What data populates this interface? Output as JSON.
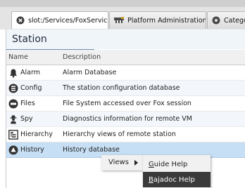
{
  "tabs": [
    {
      "label": "slot:/Services/FoxService",
      "icon": "close-circle-icon"
    },
    {
      "label": "Platform Administration",
      "icon": "platform-admin-icon"
    },
    {
      "label": "Catego",
      "icon": "category-icon"
    }
  ],
  "view": {
    "title": "Station",
    "columns": {
      "name": "Name",
      "description": "Description"
    },
    "rows": [
      {
        "name": "Alarm",
        "description": "Alarm Database",
        "icon": "bell-icon"
      },
      {
        "name": "Config",
        "description": "The station configuration database",
        "icon": "database-icon"
      },
      {
        "name": "Files",
        "description": "File System accessed over Fox session",
        "icon": "drive-icon"
      },
      {
        "name": "Spy",
        "description": "Diagnostics information for remote VM",
        "icon": "spy-icon"
      },
      {
        "name": "Hierarchy",
        "description": "Hierarchy views of remote station",
        "icon": "hierarchy-icon"
      },
      {
        "name": "History",
        "description": "History database",
        "icon": "history-db-icon"
      }
    ]
  },
  "context_menu": {
    "item": "Views",
    "submenu": [
      {
        "label_underline": "G",
        "label_rest": "uide Help"
      },
      {
        "label_underline": "B",
        "label_rest": "ajadoc Help"
      }
    ]
  }
}
